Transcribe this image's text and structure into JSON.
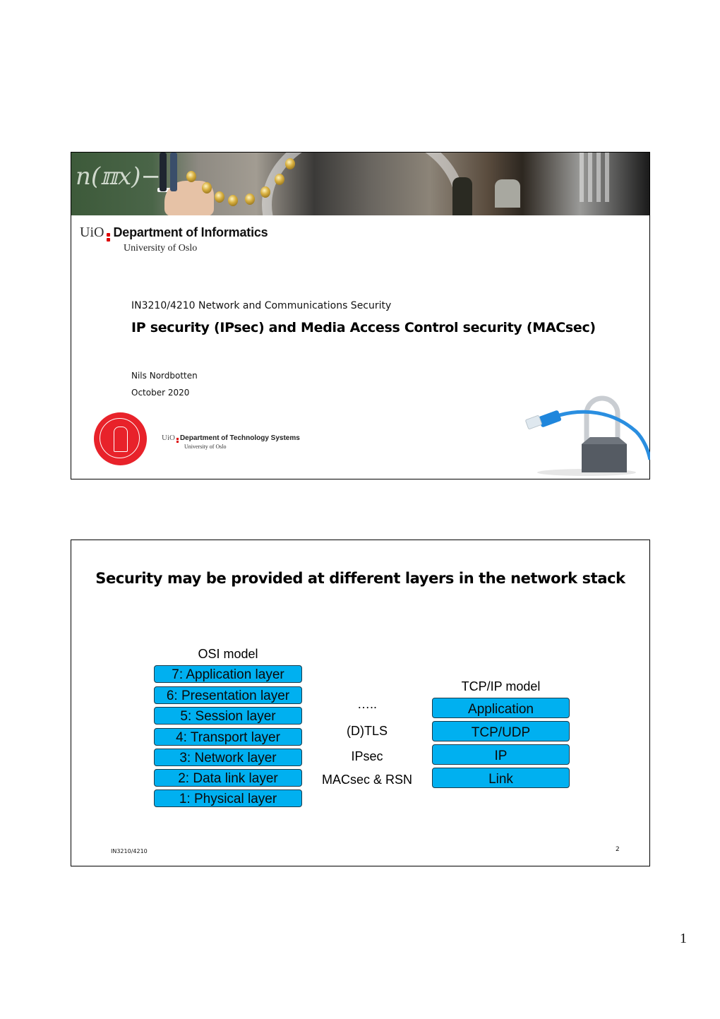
{
  "slide1": {
    "logo_top": {
      "uio": "UiO",
      "department": "Department of Informatics",
      "university": "University of Oslo"
    },
    "course": "IN3210/4210 Network and Communications Security",
    "title": "IP security (IPsec) and Media Access Control security (MACsec)",
    "author": "Nils Nordbotten",
    "date": "October 2020",
    "logo_bottom": {
      "uio": "UiO",
      "department": "Department of Technology Systems",
      "university": "University of Oslo"
    },
    "images": {
      "banner": "campus-collage-banner",
      "seal": "university-of-oslo-seal",
      "illustration": "padlock-with-network-cable"
    }
  },
  "slide2": {
    "title": "Security may be provided at different layers in the network stack",
    "osi": {
      "heading": "OSI model",
      "layers": [
        "7: Application layer",
        "6: Presentation layer",
        "5: Session layer",
        "4: Transport layer",
        "3: Network layer",
        "2: Data link layer",
        "1: Physical layer"
      ]
    },
    "protocols": [
      "…..",
      "(D)TLS",
      "IPsec",
      "MACsec & RSN"
    ],
    "tcpip": {
      "heading": "TCP/IP model",
      "layers": [
        "Application",
        "TCP/UDP",
        "IP",
        "Link"
      ]
    },
    "footer_left": "IN3210/4210",
    "footer_right": "2",
    "colors": {
      "layer_box": "#00b0f0"
    }
  },
  "page_number": "1"
}
